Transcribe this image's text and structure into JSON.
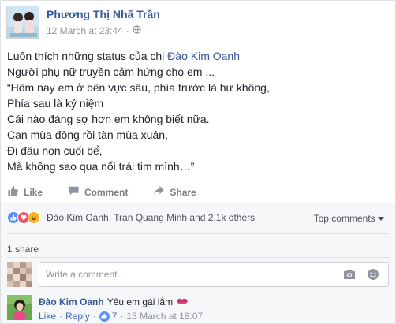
{
  "post": {
    "author": "Phương Thị Nhã Trần",
    "timestamp": "12 March at 23:44",
    "audience_icon": "globe-icon",
    "body_line1_prefix": "Luôn thích những status của chị ",
    "body_line1_mention": "Đào Kim Oanh",
    "body_lines": [
      "Người phụ nữ truyền cảm hứng cho em ...",
      "“Hôm nay em ở bên vực sâu, phía trước là hư không,",
      "Phía sau là kỷ niệm",
      "Cái nào đáng sợ hơn em không biết nữa.",
      "Cạn mùa đông rồi tàn mùa xuân,",
      "Đi đâu non cuối bể,",
      "Mà không sao qua nổi trái tim mình…”"
    ]
  },
  "actions": {
    "like": "Like",
    "comment": "Comment",
    "share": "Share"
  },
  "reactions": {
    "names": "Đào Kim Oanh, Tran Quang Minh and 2.1k others",
    "top_comments": "Top comments",
    "colors": {
      "like": "#5890ff",
      "love": "#f25268",
      "haha": "#f7b125"
    }
  },
  "shares": "1 share",
  "write_comment": {
    "placeholder": "Write a comment..."
  },
  "comment": {
    "author": "Đào Kim Oanh",
    "text": "Yêu em gái lắm",
    "like": "Like",
    "reply": "Reply",
    "like_count": "7",
    "time": "13 March at 18:07",
    "dot": "·"
  }
}
